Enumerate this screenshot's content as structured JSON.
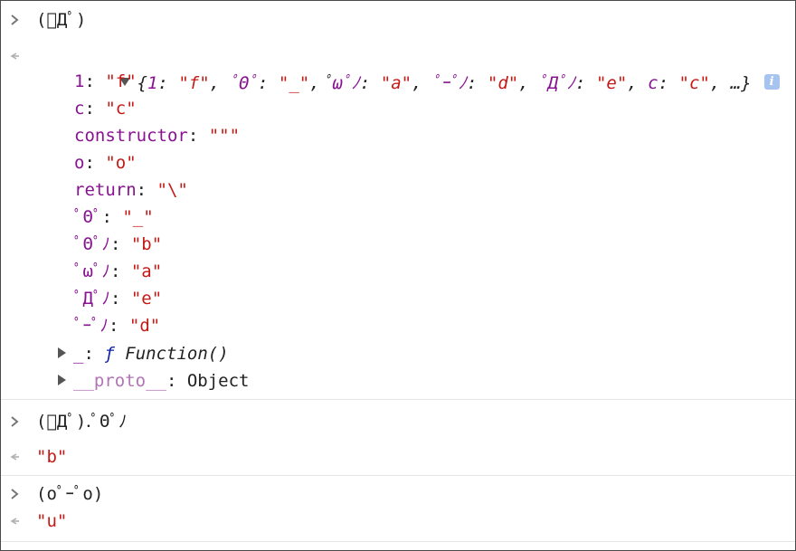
{
  "entries": [
    {
      "input": "(ﾟДﾟ)",
      "summary": {
        "open": "{",
        "items": [
          {
            "key": "1",
            "value": "\"f\""
          },
          {
            "key": "ﾟΘﾟ",
            "value": "\"_\""
          },
          {
            "key": "ﾟωﾟﾉ",
            "value": "\"a\""
          },
          {
            "key": "ﾟｰﾟﾉ",
            "value": "\"d\""
          },
          {
            "key": "ﾟДﾟﾉ",
            "value": "\"e\""
          },
          {
            "key": "c",
            "value": "\"c\""
          }
        ],
        "tail": "…}",
        "info": "i"
      },
      "props": [
        {
          "key": "1",
          "value": "\"f\""
        },
        {
          "key": "c",
          "value": "\"c\""
        },
        {
          "key": "constructor",
          "value": "\"\"\""
        },
        {
          "key": "o",
          "value": "\"o\""
        },
        {
          "key": "return",
          "value": "\"\\\""
        },
        {
          "key": "ﾟΘﾟ",
          "value": "\"_\""
        },
        {
          "key": "ﾟΘﾟﾉ",
          "value": "\"b\""
        },
        {
          "key": "ﾟωﾟﾉ",
          "value": "\"a\""
        },
        {
          "key": "ﾟДﾟﾉ",
          "value": "\"e\""
        },
        {
          "key": "ﾟｰﾟﾉ",
          "value": "\"d\""
        }
      ],
      "expandables": [
        {
          "key": "_",
          "fkw": "ƒ",
          "value": "Function()"
        },
        {
          "key": "__proto__",
          "value": "Object"
        }
      ]
    },
    {
      "input": "(ﾟДﾟ).ﾟΘﾟﾉ",
      "output": "\"b\""
    },
    {
      "input": "(oﾟｰﾟo)",
      "output": "\"u\""
    }
  ],
  "colors": {
    "key": "#881391",
    "string": "#c41a16",
    "function_keyword": "#0d22aa",
    "info_badge": "#a7c3f0"
  },
  "icons": {
    "input_prompt": "chevron-right-icon",
    "output_prompt": "return-arrow-icon"
  }
}
